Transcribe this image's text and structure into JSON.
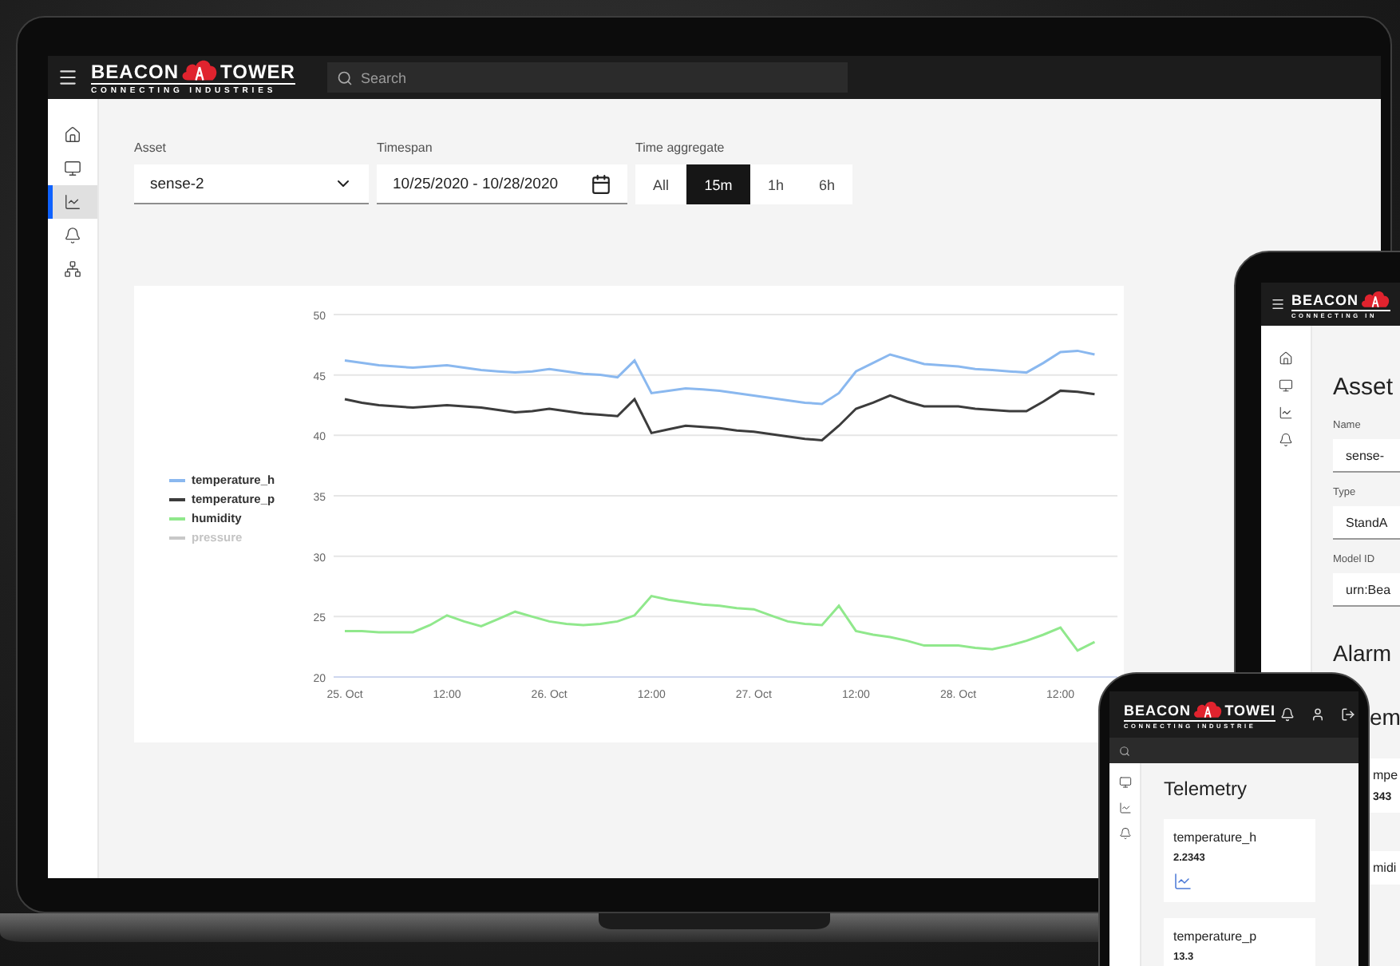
{
  "laptop": {
    "header": {
      "logo": {
        "word_left": "BEACON",
        "word_right": "TOWER",
        "tagline": "CONNECTING INDUSTRIES"
      },
      "search": {
        "placeholder": "Search"
      }
    },
    "sidebar": {
      "items": [
        {
          "kind": "home",
          "selected": false
        },
        {
          "kind": "dashboard",
          "selected": false
        },
        {
          "kind": "chart",
          "selected": true
        },
        {
          "kind": "alarms",
          "selected": false
        },
        {
          "kind": "network",
          "selected": false
        }
      ]
    },
    "filters": {
      "asset": {
        "label": "Asset",
        "value": "sense-2"
      },
      "timespan": {
        "label": "Timespan",
        "value": "10/25/2020 - 10/28/2020"
      },
      "aggregate": {
        "label": "Time aggregate",
        "options": [
          {
            "label": "All",
            "selected": false
          },
          {
            "label": "15m",
            "selected": true
          },
          {
            "label": "1h",
            "selected": false
          },
          {
            "label": "6h",
            "selected": false
          }
        ]
      }
    },
    "chart": {
      "chart_data": {
        "type": "line",
        "categories": [
          "25. Oct",
          null,
          null,
          null,
          null,
          null,
          "12:00",
          null,
          null,
          null,
          null,
          null,
          "26. Oct",
          null,
          null,
          null,
          null,
          null,
          "12:00",
          null,
          null,
          null,
          null,
          null,
          "27. Oct",
          null,
          null,
          null,
          null,
          null,
          "12:00",
          null,
          null,
          null,
          null,
          null,
          "28. Oct",
          null,
          null,
          null,
          null,
          null,
          "12:00",
          null,
          null
        ],
        "ylim": [
          20,
          50
        ],
        "grid": true,
        "yticks": [
          20,
          25,
          30,
          35,
          40,
          45,
          50
        ],
        "series": [
          {
            "name": "temperature_h",
            "color": "#8ab8ef",
            "values": [
              46.2,
              46.0,
              45.8,
              45.7,
              45.6,
              45.7,
              45.8,
              45.6,
              45.4,
              45.3,
              45.2,
              45.3,
              45.5,
              45.3,
              45.1,
              45.0,
              44.8,
              46.2,
              43.5,
              43.7,
              43.9,
              43.8,
              43.7,
              43.5,
              43.3,
              43.1,
              42.9,
              42.7,
              42.6,
              43.5,
              45.3,
              46.0,
              46.7,
              46.3,
              45.9,
              45.8,
              45.7,
              45.5,
              45.4,
              45.3,
              45.2,
              46.0,
              46.9,
              47.0,
              46.7
            ]
          },
          {
            "name": "temperature_p",
            "color": "#3c3c3c",
            "values": [
              43.0,
              42.7,
              42.5,
              42.4,
              42.3,
              42.4,
              42.5,
              42.4,
              42.3,
              42.1,
              41.9,
              42.0,
              42.2,
              42.0,
              41.8,
              41.7,
              41.6,
              43.0,
              40.2,
              40.5,
              40.8,
              40.7,
              40.6,
              40.4,
              40.3,
              40.1,
              39.9,
              39.7,
              39.6,
              40.8,
              42.2,
              42.7,
              43.3,
              42.8,
              42.4,
              42.4,
              42.4,
              42.2,
              42.1,
              42.0,
              42.0,
              42.8,
              43.7,
              43.6,
              43.4
            ]
          },
          {
            "name": "humidity",
            "color": "#90e88c",
            "values": [
              23.8,
              23.8,
              23.7,
              23.7,
              23.7,
              24.3,
              25.1,
              24.6,
              24.2,
              24.8,
              25.4,
              25.0,
              24.6,
              24.4,
              24.3,
              24.4,
              24.6,
              25.1,
              26.7,
              26.4,
              26.2,
              26.0,
              25.9,
              25.7,
              25.6,
              25.1,
              24.6,
              24.4,
              24.3,
              25.9,
              23.8,
              23.5,
              23.3,
              23.0,
              22.6,
              22.6,
              22.6,
              22.4,
              22.3,
              22.6,
              23.0,
              23.5,
              24.1,
              22.2,
              22.9
            ]
          }
        ]
      },
      "hidden_series": [
        {
          "name": "pressure",
          "color": "#c8c8c8"
        }
      ]
    }
  },
  "tablet": {
    "header": {
      "logo": {
        "word_left": "BEACON",
        "tagline": "CONNECTING IN"
      }
    },
    "sidebar": {
      "items": [
        {
          "kind": "home"
        },
        {
          "kind": "dashboard"
        },
        {
          "kind": "chart"
        },
        {
          "kind": "alarms"
        }
      ]
    },
    "title": "Asset",
    "fields": [
      {
        "label": "Name",
        "value": "sense-"
      },
      {
        "label": "Type",
        "value": "StandA"
      },
      {
        "label": "Model ID",
        "value": "urn:Bea"
      }
    ],
    "section": "Alarm",
    "fragment": {
      "heading": "em",
      "cards": [
        {
          "label": "mpe",
          "value": "343"
        },
        {
          "label": "midi"
        }
      ]
    }
  },
  "phone": {
    "header": {
      "logo": {
        "word_left": "BEACON",
        "word_right": "TOWEI",
        "tagline": "CONNECTING INDUSTRIE"
      }
    },
    "sidebar": {
      "items": [
        {
          "kind": "dashboard"
        },
        {
          "kind": "chart"
        },
        {
          "kind": "alarms"
        }
      ]
    },
    "title": "Telemetry",
    "cards": [
      {
        "label": "temperature_h",
        "value": "2.2343"
      },
      {
        "label": "temperature_p",
        "value": "13.3"
      }
    ]
  }
}
